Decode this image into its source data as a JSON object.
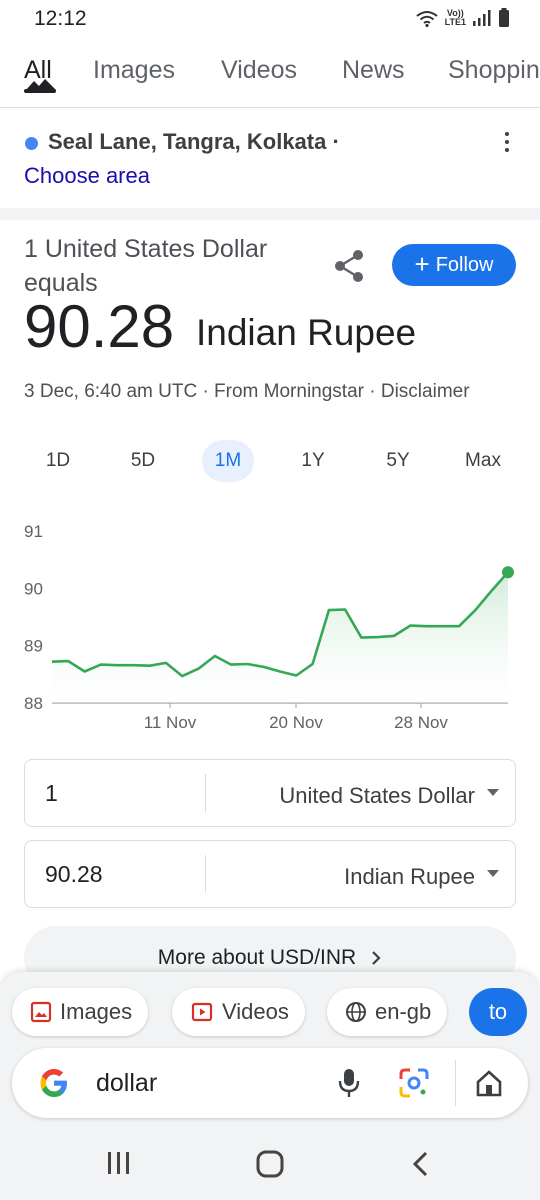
{
  "status_bar": {
    "time": "12:12",
    "network_label_top": "Vo))",
    "network_label_bottom": "LTE1"
  },
  "tabs": [
    {
      "label": "All",
      "active": true
    },
    {
      "label": "Images",
      "active": false
    },
    {
      "label": "Videos",
      "active": false
    },
    {
      "label": "News",
      "active": false
    },
    {
      "label": "Shopping",
      "active": false
    }
  ],
  "location": {
    "name": "Seal Lane, Tangra, Kolkata ·",
    "link": "Choose area",
    "dot_color": "#4285f4"
  },
  "currency": {
    "from_text": "1 United States Dollar equals",
    "value": "90.28",
    "unit": "Indian Rupee",
    "meta": "3 Dec, 6:40 am UTC · From Morningstar · Disclaimer",
    "follow_label": "Follow",
    "accent_color": "#1a73e8"
  },
  "ranges": [
    {
      "label": "1D",
      "active": false
    },
    {
      "label": "5D",
      "active": false
    },
    {
      "label": "1M",
      "active": true
    },
    {
      "label": "1Y",
      "active": false
    },
    {
      "label": "5Y",
      "active": false
    },
    {
      "label": "Max",
      "active": false
    }
  ],
  "chart_data": {
    "type": "area",
    "title": "",
    "xlabel": "",
    "ylabel": "",
    "x": [
      "1 Nov",
      "2 Nov",
      "4 Nov",
      "5 Nov",
      "6 Nov",
      "7 Nov",
      "8 Nov",
      "11 Nov",
      "12 Nov",
      "13 Nov",
      "14 Nov",
      "15 Nov",
      "18 Nov",
      "19 Nov",
      "20 Nov",
      "21 Nov",
      "22 Nov",
      "25 Nov",
      "26 Nov",
      "27 Nov",
      "28 Nov",
      "29 Nov",
      "2 Dec",
      "3 Dec"
    ],
    "y": [
      88.72,
      88.73,
      88.55,
      88.67,
      88.66,
      88.66,
      88.65,
      88.7,
      88.47,
      88.6,
      88.82,
      88.67,
      88.68,
      88.63,
      88.55,
      88.48,
      88.68,
      89.62,
      89.63,
      89.14,
      89.15,
      89.17,
      89.35,
      89.34,
      89.34,
      89.34,
      89.62,
      89.96,
      90.28
    ],
    "x_tick_labels": [
      "11 Nov",
      "20 Nov",
      "28 Nov"
    ],
    "y_tick_labels": [
      "88",
      "89",
      "90",
      "91"
    ],
    "ylim": [
      88,
      91
    ],
    "grid": false,
    "line_color": "#34a853",
    "fill_color": "#e6f4ea"
  },
  "converter": {
    "from": {
      "amount": "1",
      "currency": "United States Dollar"
    },
    "to": {
      "amount": "90.28",
      "currency": "Indian Rupee"
    }
  },
  "more_about": "More about USD/INR",
  "chips": [
    {
      "label": "Images",
      "icon": "image-icon"
    },
    {
      "label": "Videos",
      "icon": "video-icon"
    },
    {
      "label": "en-gb",
      "icon": "globe-icon"
    },
    {
      "label": "to",
      "icon": ""
    }
  ],
  "search": {
    "query": "dollar"
  }
}
